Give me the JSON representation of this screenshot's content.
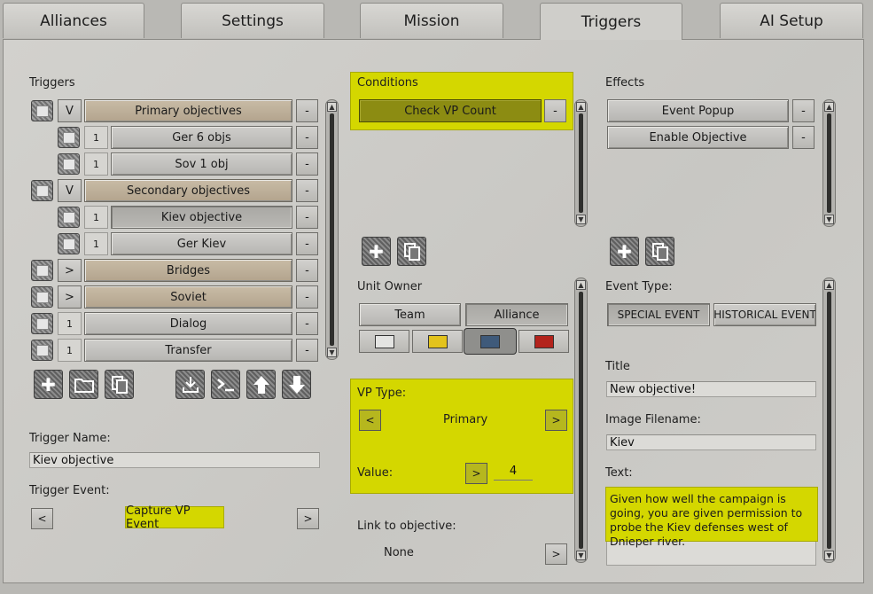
{
  "tabs": [
    "Alliances",
    "Settings",
    "Mission",
    "Triggers",
    "AI Setup"
  ],
  "triggers": {
    "heading": "Triggers",
    "rows": [
      {
        "toggle": "V",
        "label": "Primary objectives",
        "indent": false,
        "group": true
      },
      {
        "toggle": "1",
        "label": "Ger 6 objs",
        "indent": true,
        "group": false
      },
      {
        "toggle": "1",
        "label": "Sov 1 obj",
        "indent": true,
        "group": false
      },
      {
        "toggle": "V",
        "label": "Secondary objectives",
        "indent": false,
        "group": true
      },
      {
        "toggle": "1",
        "label": "Kiev objective",
        "indent": true,
        "group": false,
        "selected": true
      },
      {
        "toggle": "1",
        "label": "Ger Kiev",
        "indent": true,
        "group": false
      },
      {
        "toggle": ">",
        "label": "Bridges",
        "indent": false,
        "group": true
      },
      {
        "toggle": ">",
        "label": "Soviet",
        "indent": false,
        "group": true
      },
      {
        "toggle": "1",
        "label": "Dialog",
        "indent": false,
        "group": false
      },
      {
        "toggle": "1",
        "label": "Transfer",
        "indent": false,
        "group": false
      }
    ],
    "remove_label": "-",
    "trigger_name_label": "Trigger Name:",
    "trigger_name_value": "Kiev objective",
    "trigger_event_label": "Trigger Event:",
    "trigger_event_value": "Capture VP Event",
    "prev_label": "<",
    "next_label": ">"
  },
  "conditions": {
    "heading": "Conditions",
    "items": [
      "Check VP Count"
    ],
    "unit_owner_label": "Unit Owner",
    "owner_team": "Team",
    "owner_alliance": "Alliance",
    "colors": [
      "#e4e4e2",
      "#e3c31c",
      "#3f5a7a",
      "#b3231c"
    ],
    "vp_type_label": "VP Type:",
    "vp_type_value": "Primary",
    "value_label": "Value:",
    "value": "4",
    "link_label": "Link to objective:",
    "link_value": "None"
  },
  "effects": {
    "heading": "Effects",
    "items": [
      "Event Popup",
      "Enable Objective"
    ],
    "event_type_label": "Event Type:",
    "special_event": "SPECIAL EVENT",
    "historical_event": "HISTORICAL EVENT",
    "title_label": "Title",
    "title_value": "New objective!",
    "image_label": "Image Filename:",
    "image_value": "Kiev",
    "text_label": "Text:",
    "text_value": "Given how well the campaign is going, you are given permission to probe the Kiev defenses west of Dnieper river."
  }
}
